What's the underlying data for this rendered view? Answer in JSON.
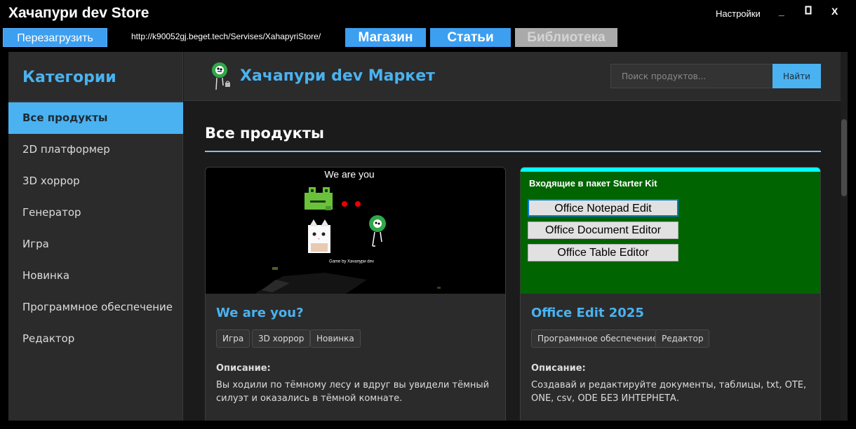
{
  "window": {
    "title": "Хачапури dev Store",
    "settings": "Настройки",
    "minimize": "_",
    "maximize": "▯",
    "close": "X"
  },
  "toolbar": {
    "reload": "Перезагрузить",
    "url": "http://k90052gj.beget.tech/Servises/XahapyriStore/",
    "tabs": [
      "Магазин",
      "Статьи",
      "Библиотека"
    ]
  },
  "sidebar": {
    "title": "Категории",
    "items": [
      "Все продукты",
      "2D платформер",
      "3D хоррор",
      "Генератор",
      "Игра",
      "Новинка",
      "Программное обеспечение",
      "Редактор"
    ],
    "active_index": 0
  },
  "header": {
    "brand": "Хачапури dev Маркет",
    "search_placeholder": "Поиск продуктов...",
    "search_button": "Найти"
  },
  "content": {
    "section_title": "Все продукты",
    "products": [
      {
        "title": "We are you?",
        "image": {
          "caption_top": "We are you",
          "caption_bottom": "Game by Хачапури dev"
        },
        "tags": [
          "Игра",
          "3D хоррор",
          "Новинка"
        ],
        "desc_label": "Описание:",
        "description": "Вы ходили по тёмному лесу и вдруг вы увидели тёмный силуэт и оказались в тёмной комнате."
      },
      {
        "title": "Office Edit 2025",
        "image": {
          "heading": "Входящие в пакет Starter Kit",
          "buttons": [
            "Office Notepad Edit",
            "Office Document Editor",
            "Office Table Editor"
          ]
        },
        "tags": [
          "Программное обеспечение",
          "Редактор"
        ],
        "desc_label": "Описание:",
        "description": "Создавай и редактируйте документы, таблицы, txt, OTE, ONE, csv, ODE БЕЗ ИНТЕРНЕТА."
      }
    ]
  },
  "colors": {
    "accent": "#4ab2f0",
    "toolbar_button": "#3d9ff0",
    "disabled_tab": "#aaaaaa",
    "panel": "#2b2b2b",
    "background": "#1b1b1b",
    "office_green": "#006400",
    "office_top_strip": "#00ffff"
  }
}
